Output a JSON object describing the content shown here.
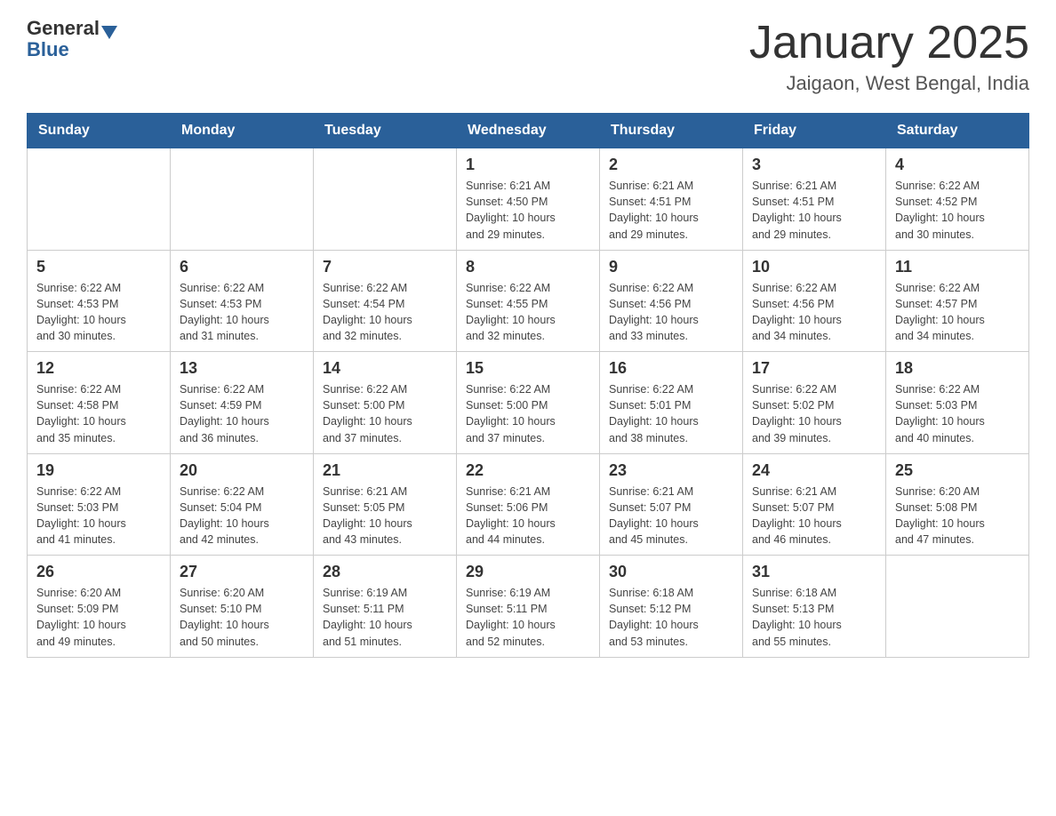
{
  "header": {
    "logo_line1": "General",
    "logo_line2": "Blue",
    "title": "January 2025",
    "subtitle": "Jaigaon, West Bengal, India"
  },
  "calendar": {
    "weekdays": [
      "Sunday",
      "Monday",
      "Tuesday",
      "Wednesday",
      "Thursday",
      "Friday",
      "Saturday"
    ],
    "weeks": [
      [
        {
          "day": "",
          "info": ""
        },
        {
          "day": "",
          "info": ""
        },
        {
          "day": "",
          "info": ""
        },
        {
          "day": "1",
          "info": "Sunrise: 6:21 AM\nSunset: 4:50 PM\nDaylight: 10 hours\nand 29 minutes."
        },
        {
          "day": "2",
          "info": "Sunrise: 6:21 AM\nSunset: 4:51 PM\nDaylight: 10 hours\nand 29 minutes."
        },
        {
          "day": "3",
          "info": "Sunrise: 6:21 AM\nSunset: 4:51 PM\nDaylight: 10 hours\nand 29 minutes."
        },
        {
          "day": "4",
          "info": "Sunrise: 6:22 AM\nSunset: 4:52 PM\nDaylight: 10 hours\nand 30 minutes."
        }
      ],
      [
        {
          "day": "5",
          "info": "Sunrise: 6:22 AM\nSunset: 4:53 PM\nDaylight: 10 hours\nand 30 minutes."
        },
        {
          "day": "6",
          "info": "Sunrise: 6:22 AM\nSunset: 4:53 PM\nDaylight: 10 hours\nand 31 minutes."
        },
        {
          "day": "7",
          "info": "Sunrise: 6:22 AM\nSunset: 4:54 PM\nDaylight: 10 hours\nand 32 minutes."
        },
        {
          "day": "8",
          "info": "Sunrise: 6:22 AM\nSunset: 4:55 PM\nDaylight: 10 hours\nand 32 minutes."
        },
        {
          "day": "9",
          "info": "Sunrise: 6:22 AM\nSunset: 4:56 PM\nDaylight: 10 hours\nand 33 minutes."
        },
        {
          "day": "10",
          "info": "Sunrise: 6:22 AM\nSunset: 4:56 PM\nDaylight: 10 hours\nand 34 minutes."
        },
        {
          "day": "11",
          "info": "Sunrise: 6:22 AM\nSunset: 4:57 PM\nDaylight: 10 hours\nand 34 minutes."
        }
      ],
      [
        {
          "day": "12",
          "info": "Sunrise: 6:22 AM\nSunset: 4:58 PM\nDaylight: 10 hours\nand 35 minutes."
        },
        {
          "day": "13",
          "info": "Sunrise: 6:22 AM\nSunset: 4:59 PM\nDaylight: 10 hours\nand 36 minutes."
        },
        {
          "day": "14",
          "info": "Sunrise: 6:22 AM\nSunset: 5:00 PM\nDaylight: 10 hours\nand 37 minutes."
        },
        {
          "day": "15",
          "info": "Sunrise: 6:22 AM\nSunset: 5:00 PM\nDaylight: 10 hours\nand 37 minutes."
        },
        {
          "day": "16",
          "info": "Sunrise: 6:22 AM\nSunset: 5:01 PM\nDaylight: 10 hours\nand 38 minutes."
        },
        {
          "day": "17",
          "info": "Sunrise: 6:22 AM\nSunset: 5:02 PM\nDaylight: 10 hours\nand 39 minutes."
        },
        {
          "day": "18",
          "info": "Sunrise: 6:22 AM\nSunset: 5:03 PM\nDaylight: 10 hours\nand 40 minutes."
        }
      ],
      [
        {
          "day": "19",
          "info": "Sunrise: 6:22 AM\nSunset: 5:03 PM\nDaylight: 10 hours\nand 41 minutes."
        },
        {
          "day": "20",
          "info": "Sunrise: 6:22 AM\nSunset: 5:04 PM\nDaylight: 10 hours\nand 42 minutes."
        },
        {
          "day": "21",
          "info": "Sunrise: 6:21 AM\nSunset: 5:05 PM\nDaylight: 10 hours\nand 43 minutes."
        },
        {
          "day": "22",
          "info": "Sunrise: 6:21 AM\nSunset: 5:06 PM\nDaylight: 10 hours\nand 44 minutes."
        },
        {
          "day": "23",
          "info": "Sunrise: 6:21 AM\nSunset: 5:07 PM\nDaylight: 10 hours\nand 45 minutes."
        },
        {
          "day": "24",
          "info": "Sunrise: 6:21 AM\nSunset: 5:07 PM\nDaylight: 10 hours\nand 46 minutes."
        },
        {
          "day": "25",
          "info": "Sunrise: 6:20 AM\nSunset: 5:08 PM\nDaylight: 10 hours\nand 47 minutes."
        }
      ],
      [
        {
          "day": "26",
          "info": "Sunrise: 6:20 AM\nSunset: 5:09 PM\nDaylight: 10 hours\nand 49 minutes."
        },
        {
          "day": "27",
          "info": "Sunrise: 6:20 AM\nSunset: 5:10 PM\nDaylight: 10 hours\nand 50 minutes."
        },
        {
          "day": "28",
          "info": "Sunrise: 6:19 AM\nSunset: 5:11 PM\nDaylight: 10 hours\nand 51 minutes."
        },
        {
          "day": "29",
          "info": "Sunrise: 6:19 AM\nSunset: 5:11 PM\nDaylight: 10 hours\nand 52 minutes."
        },
        {
          "day": "30",
          "info": "Sunrise: 6:18 AM\nSunset: 5:12 PM\nDaylight: 10 hours\nand 53 minutes."
        },
        {
          "day": "31",
          "info": "Sunrise: 6:18 AM\nSunset: 5:13 PM\nDaylight: 10 hours\nand 55 minutes."
        },
        {
          "day": "",
          "info": ""
        }
      ]
    ]
  }
}
